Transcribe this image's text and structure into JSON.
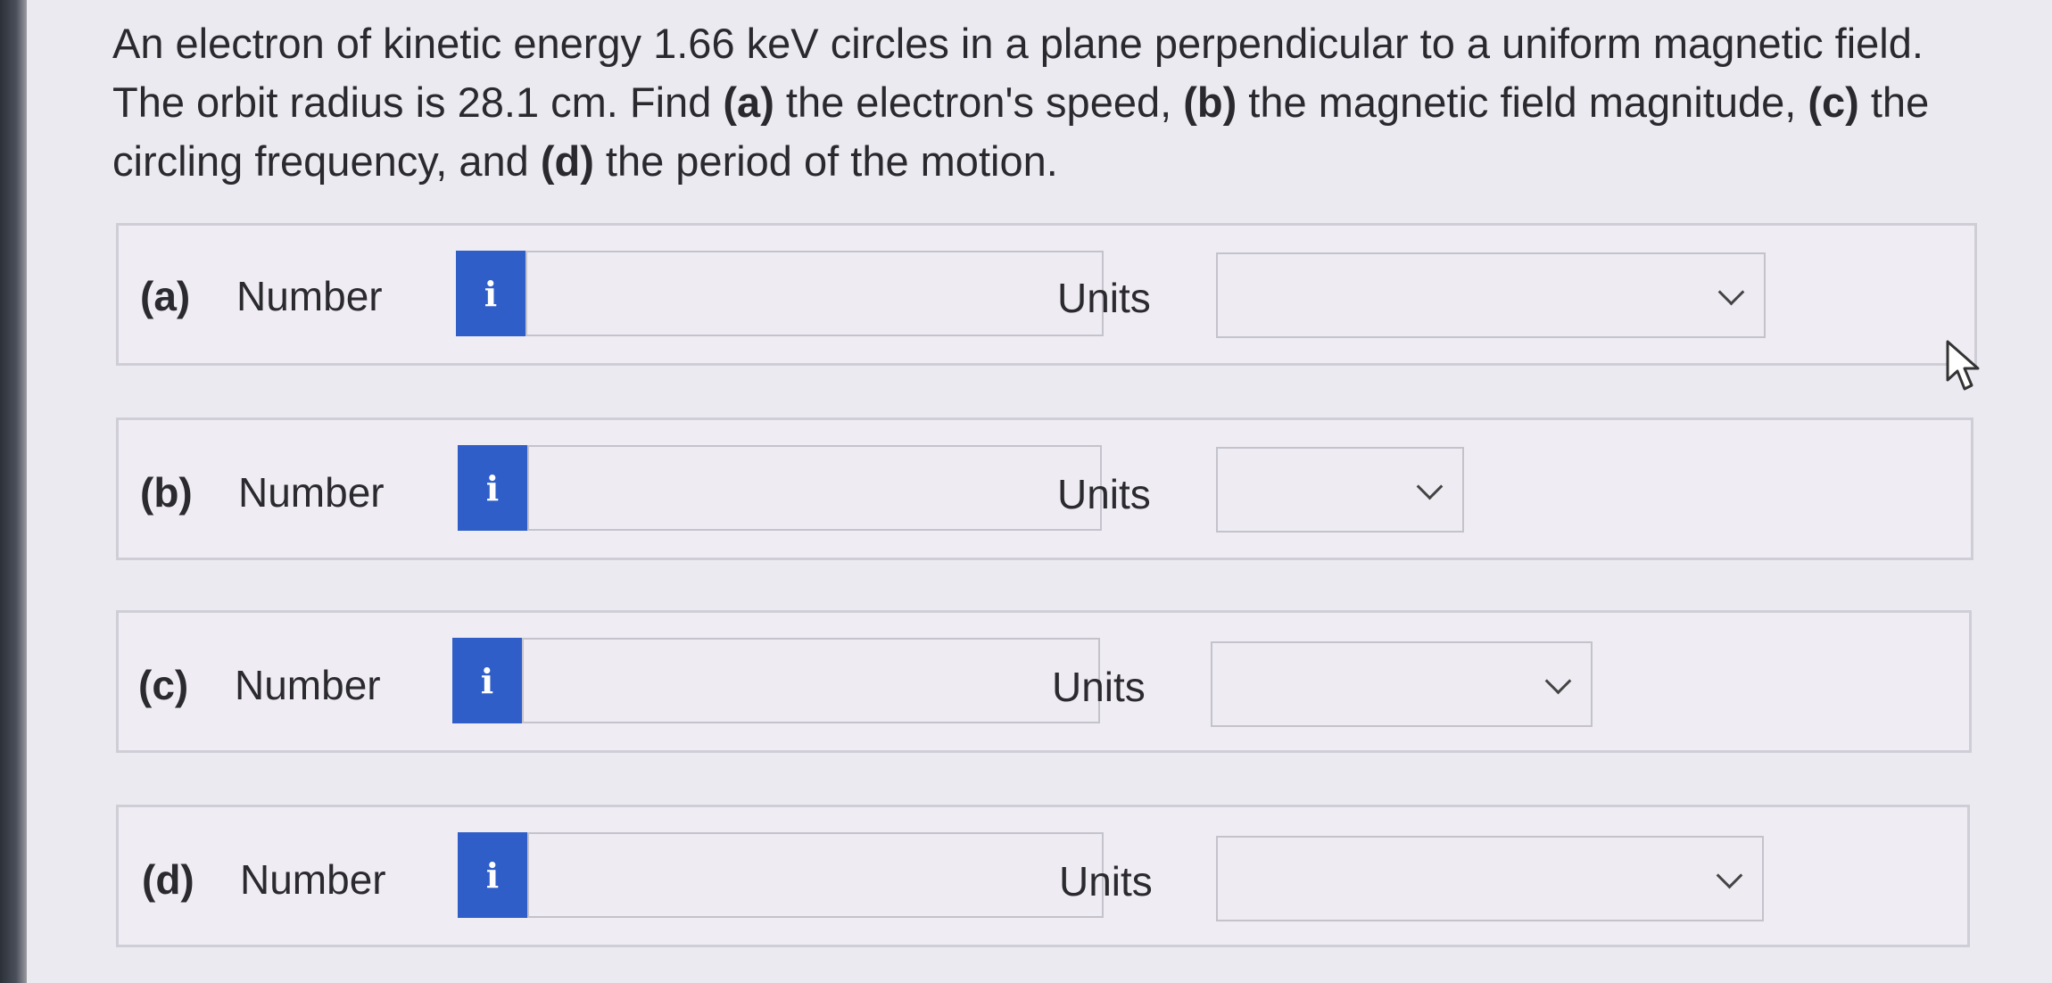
{
  "question": {
    "text_1": "An electron of kinetic energy 1.66 keV circles in a plane perpendicular to a uniform magnetic field.",
    "text_2": "The orbit radius is 28.1 cm. Find ",
    "a": "(a)",
    "text_3": " the electron's speed, ",
    "b": "(b)",
    "text_4": " the magnetic field magnitude, ",
    "c": "(c)",
    "text_5": " the circling frequency, and ",
    "d": "(d)",
    "text_6": " the period of the motion."
  },
  "parts": [
    {
      "label": "(a)",
      "number_label": "Number",
      "info_icon": "i",
      "number_value": "",
      "units_label": "Units",
      "units_value": ""
    },
    {
      "label": "(b)",
      "number_label": "Number",
      "info_icon": "i",
      "number_value": "",
      "units_label": "Units",
      "units_value": ""
    },
    {
      "label": "(c)",
      "number_label": "Number",
      "info_icon": "i",
      "number_value": "",
      "units_label": "Units",
      "units_value": ""
    },
    {
      "label": "(d)",
      "number_label": "Number",
      "info_icon": "i",
      "number_value": "",
      "units_label": "Units",
      "units_value": ""
    }
  ],
  "colors": {
    "info_button": "#2f5ec8",
    "background": "#eceaf1"
  },
  "icons": {
    "info": "info-icon",
    "dropdown": "chevron-down-icon",
    "pointer": "mouse-pointer-icon"
  }
}
